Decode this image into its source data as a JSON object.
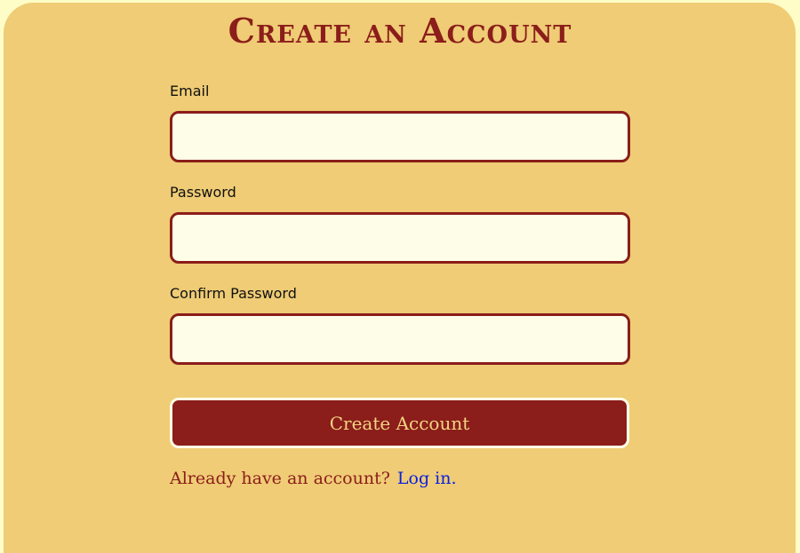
{
  "form": {
    "title": "Create an Account",
    "email": {
      "label": "Email",
      "value": "",
      "placeholder": ""
    },
    "password": {
      "label": "Password",
      "value": "",
      "placeholder": ""
    },
    "confirm_password": {
      "label": "Confirm Password",
      "value": "",
      "placeholder": ""
    },
    "submit_label": "Create Account",
    "login_prompt": "Already have an account?",
    "login_link": "Log in."
  },
  "colors": {
    "page_background": "#fefdc8",
    "card_background": "#efcc75",
    "accent": "#8b1d1a",
    "input_background": "#fefde8",
    "link": "#0a1ee0"
  }
}
